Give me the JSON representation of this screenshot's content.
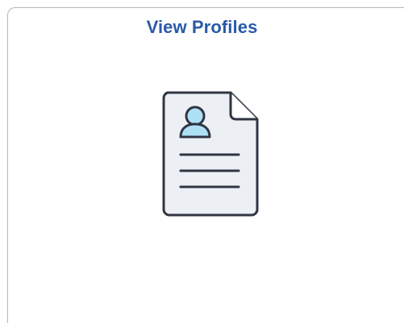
{
  "tile": {
    "title": "View Profiles",
    "icon": "profile-document-icon"
  },
  "colors": {
    "title": "#2a5aa8",
    "border": "#b9b9b9",
    "doc_fill": "#eceff3",
    "doc_stroke": "#2f3542",
    "avatar_fill": "#aee0f5"
  }
}
